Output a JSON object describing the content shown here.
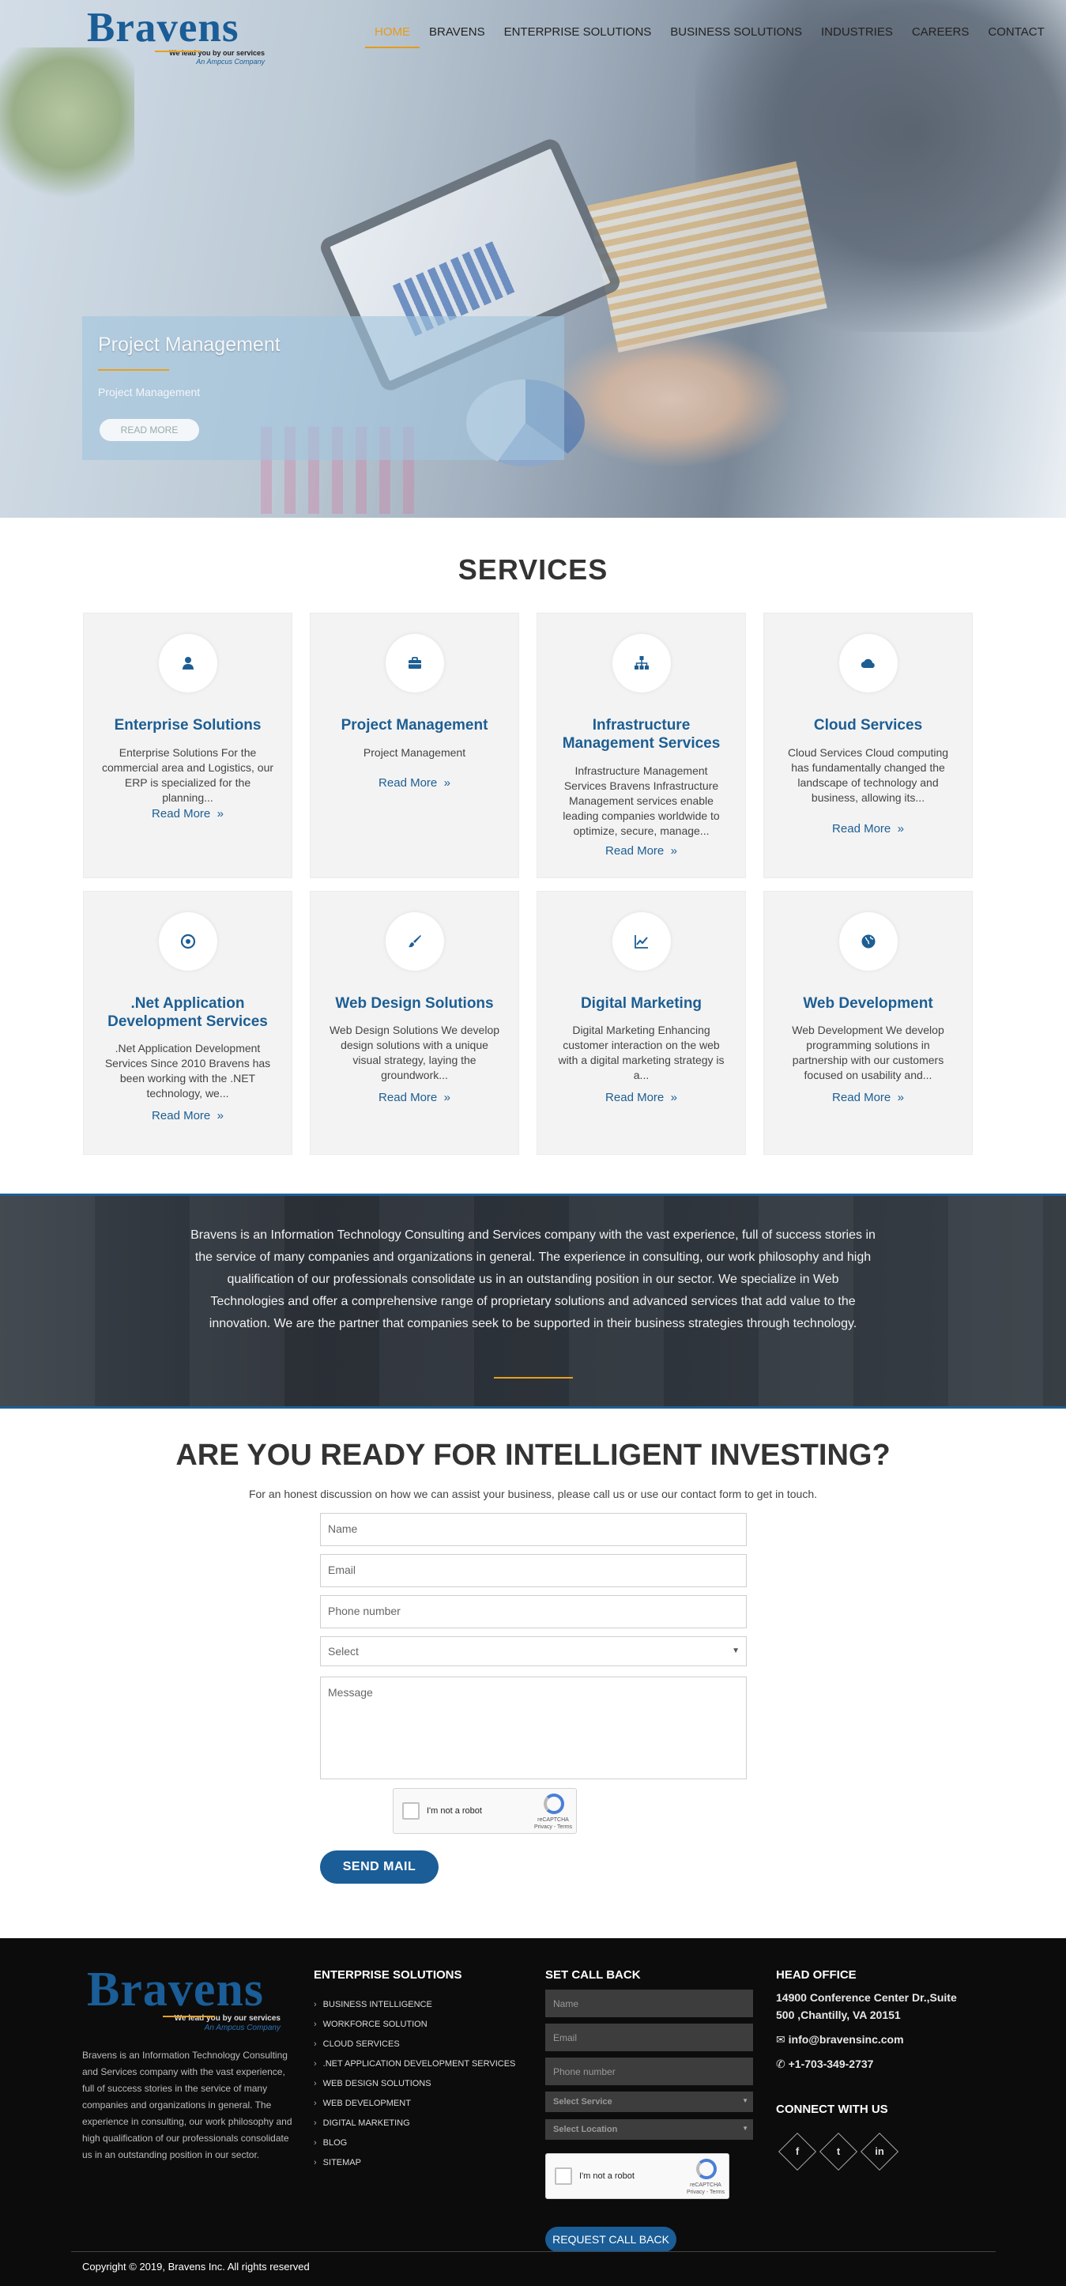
{
  "brand": {
    "name": "Bravens",
    "tagline": "We lead you by our services",
    "subtag": "An Ampcus Company"
  },
  "nav": {
    "items": [
      "HOME",
      "BRAVENS",
      "ENTERPRISE SOLUTIONS",
      "BUSINESS SOLUTIONS",
      "INDUSTRIES",
      "CAREERS",
      "CONTACT"
    ],
    "active": "HOME"
  },
  "hero": {
    "title": "Project Management",
    "subtitle": "Project Management",
    "button": "READ MORE"
  },
  "services": {
    "heading": "SERVICES",
    "read_more": "Read More",
    "cards": [
      {
        "title": "Enterprise Solutions",
        "desc": "Enterprise Solutions For the commercial area and Logistics, our ERP is specialized for the planning...",
        "icon": "user-icon"
      },
      {
        "title": "Project Management",
        "desc": "Project Management",
        "icon": "briefcase-icon"
      },
      {
        "title": "Infrastructure Management Services",
        "desc": "Infrastructure Management Services Bravens Infrastructure Management services enable leading companies worldwide to optimize, secure, manage...",
        "icon": "sitemap-icon"
      },
      {
        "title": "Cloud Services",
        "desc": "Cloud Services Cloud computing has fundamentally changed the landscape of technology and business, allowing its...",
        "icon": "cloud-icon"
      },
      {
        "title": ".Net Application Development Services",
        "desc": ".Net Application Development Services Since 2010 Bravens has been working with the .NET technology, we...",
        "icon": "target-icon"
      },
      {
        "title": "Web Design Solutions",
        "desc": "Web Design Solutions We develop design solutions with a unique visual strategy, laying the groundwork...",
        "icon": "brush-icon"
      },
      {
        "title": "Digital Marketing",
        "desc": "Digital Marketing Enhancing customer interaction on the web with a digital marketing strategy is a...",
        "icon": "line-chart-icon"
      },
      {
        "title": "Web Development",
        "desc": "Web Development We develop programming solutions in partnership with our customers focused on usability and...",
        "icon": "globe-icon"
      }
    ]
  },
  "about_band": {
    "text": "Bravens is an Information Technology Consulting and Services company with the vast experience, full of success stories in the service of many companies and organizations in general. The experience in consulting, our work philosophy and high qualification of our professionals consolidate us in an outstanding position in our sector. We specialize in Web Technologies and offer a comprehensive range of proprietary solutions and advanced services that add value to the innovation. We are the partner that companies seek to be supported in their business strategies through technology."
  },
  "contact": {
    "heading": "ARE YOU READY FOR INTELLIGENT INVESTING?",
    "lead": "For an honest discussion on how we can assist your business, please call us or use our contact form to get in touch.",
    "name_placeholder": "Name",
    "email_placeholder": "Email",
    "phone_placeholder": "Phone number",
    "select_value": "Select",
    "message_placeholder": "Message",
    "captcha_label": "I'm not a robot",
    "captcha_brand": "reCAPTCHA",
    "captcha_terms": "Privacy - Terms",
    "send": "SEND MAIL"
  },
  "footer": {
    "about": "Bravens is an Information Technology Consulting and Services company with the vast experience, full of success stories in the service of many companies and organizations in general. The experience in consulting, our work philosophy and high qualification of our professionals consolidate us in an outstanding position in our sector.",
    "enterprise_heading": "ENTERPRISE SOLUTIONS",
    "links": [
      "BUSINESS INTELLIGENCE",
      "WORKFORCE SOLUTION",
      "CLOUD SERVICES",
      ".NET APPLICATION DEVELOPMENT SERVICES",
      "WEB DESIGN SOLUTIONS",
      "WEB DEVELOPMENT",
      "DIGITAL MARKETING",
      "BLOG",
      "SITEMAP"
    ],
    "callback_heading": "SET CALL BACK",
    "cb_name": "Name",
    "cb_email": "Email",
    "cb_phone": "Phone number",
    "cb_service": "Select Service",
    "cb_location": "Select Location",
    "cb_captcha": "I'm not a robot",
    "cb_button": "REQUEST CALL BACK",
    "office_heading": "HEAD OFFICE",
    "address_line1": "14900 Conference Center Dr.,Suite",
    "address_line2": "500 ,Chantilly, VA 20151",
    "email": "info@bravensinc.com",
    "phone": "+1-703-349-2737",
    "connect_heading": "CONNECT WITH US",
    "social": [
      "f",
      "t",
      "in"
    ],
    "copyright": "Copyright © 2019, Bravens Inc. All rights reserved"
  },
  "colors": {
    "brand_blue": "#1a5d97",
    "accent_orange": "#e79a19"
  }
}
